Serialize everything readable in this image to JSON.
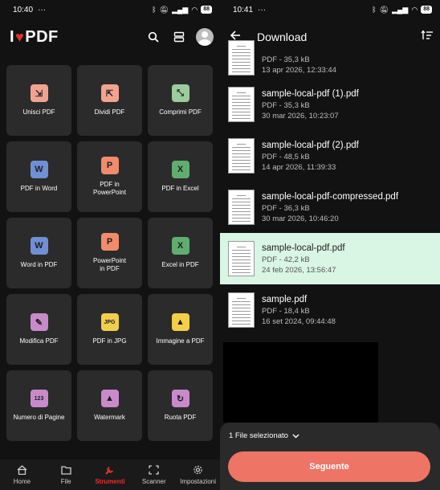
{
  "left": {
    "status": {
      "time": "10:40",
      "dots": "···",
      "battery": "88"
    },
    "logo": {
      "part1": "I",
      "heart": "♥",
      "part2": "PDF"
    },
    "tools": [
      {
        "label": "Unisci PDF",
        "icon": "merge-icon",
        "color": "#f2a38f",
        "glyph": "⇲"
      },
      {
        "label": "Dividi PDF",
        "icon": "split-icon",
        "color": "#f2a38f",
        "glyph": "⇱"
      },
      {
        "label": "Comprimi PDF",
        "icon": "compress-icon",
        "color": "#9ccc9c",
        "glyph": "⤡"
      },
      {
        "label": "PDF in Word",
        "icon": "pdf-to-word-icon",
        "color": "#6f8fd6",
        "glyph": "W"
      },
      {
        "label": "PDF in\nPowerPoint",
        "icon": "pdf-to-powerpoint-icon",
        "color": "#f08b6c",
        "glyph": "P"
      },
      {
        "label": "PDF in Excel",
        "icon": "pdf-to-excel-icon",
        "color": "#5fae6f",
        "glyph": "X"
      },
      {
        "label": "Word in PDF",
        "icon": "word-to-pdf-icon",
        "color": "#6f8fd6",
        "glyph": "W"
      },
      {
        "label": "PowerPoint\nin PDF",
        "icon": "powerpoint-to-pdf-icon",
        "color": "#f08b6c",
        "glyph": "P"
      },
      {
        "label": "Excel in PDF",
        "icon": "excel-to-pdf-icon",
        "color": "#5fae6f",
        "glyph": "X"
      },
      {
        "label": "Modifica PDF",
        "icon": "edit-pdf-icon",
        "color": "#c98ac9",
        "glyph": "✎"
      },
      {
        "label": "PDF in JPG",
        "icon": "pdf-to-jpg-icon",
        "color": "#f2cf4a",
        "glyph": "JPG"
      },
      {
        "label": "Immagine a PDF",
        "icon": "image-to-pdf-icon",
        "color": "#f2cf4a",
        "glyph": "▲"
      },
      {
        "label": "Numero di Pagine",
        "icon": "page-numbers-icon",
        "color": "#c98ac9",
        "glyph": "123"
      },
      {
        "label": "Watermark",
        "icon": "watermark-icon",
        "color": "#c98ac9",
        "glyph": "▲"
      },
      {
        "label": "Ruota PDF",
        "icon": "rotate-pdf-icon",
        "color": "#c98ac9",
        "glyph": "↻"
      }
    ],
    "nav": [
      {
        "label": "Home",
        "icon": "home-icon",
        "active": false
      },
      {
        "label": "File",
        "icon": "folder-icon",
        "active": false
      },
      {
        "label": "Strumenti",
        "icon": "wrench-icon",
        "active": true
      },
      {
        "label": "Scanner",
        "icon": "scanner-icon",
        "active": false
      },
      {
        "label": "Impostazioni",
        "icon": "gear-icon",
        "active": false
      }
    ],
    "accent": "#e5322d"
  },
  "right": {
    "status": {
      "time": "10:41",
      "dots": "···",
      "battery": "88"
    },
    "title": "Download",
    "files": [
      {
        "name": "",
        "meta1": "PDF - 35,3 kB",
        "meta2": "13 apr 2026, 12:33:44",
        "selected": false
      },
      {
        "name": "sample-local-pdf (1).pdf",
        "meta1": "PDF - 35,3 kB",
        "meta2": "30 mar 2026, 10:23:07",
        "selected": false
      },
      {
        "name": "sample-local-pdf (2).pdf",
        "meta1": "PDF - 48,5 kB",
        "meta2": "14 apr 2026, 11:39:33",
        "selected": false
      },
      {
        "name": "sample-local-pdf-compressed.pdf",
        "meta1": "PDF - 36,3 kB",
        "meta2": "30 mar 2026, 10:46:20",
        "selected": false
      },
      {
        "name": "sample-local-pdf.pdf",
        "meta1": "PDF - 42,2 kB",
        "meta2": "24 feb 2026, 13:56:47",
        "selected": true
      },
      {
        "name": "sample.pdf",
        "meta1": "PDF - 18,4 kB",
        "meta2": "16 set 2024, 09:44:48",
        "selected": false
      }
    ],
    "selection_label": "1 File selezionato",
    "next_label": "Seguente",
    "selected_color": "#d9f5e3",
    "button_color": "#ee7465"
  }
}
